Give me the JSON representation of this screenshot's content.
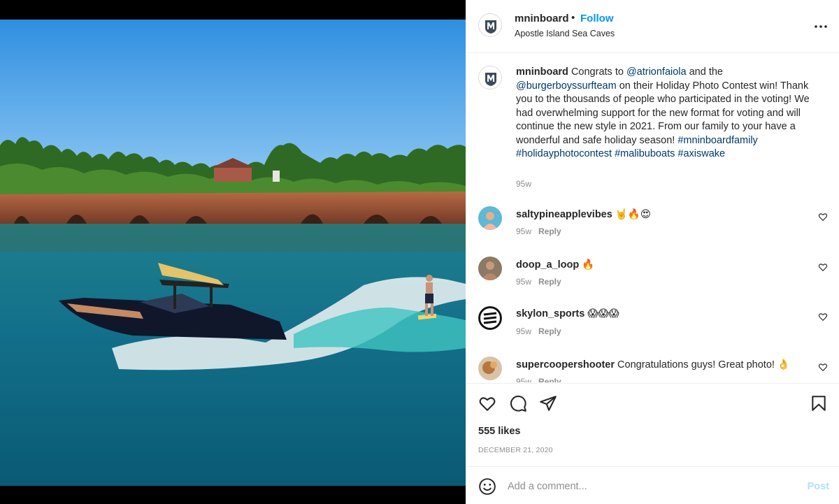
{
  "post": {
    "image_alt": "Wakesurf boat on lake near sandstone sea cave cliffs",
    "account": {
      "username": "mninboard",
      "separator": "•",
      "follow_label": "Follow",
      "location": "Apostle Island Sea Caves"
    },
    "caption": {
      "username": "mninboard",
      "t1": " Congrats to ",
      "mention1": "@atrionfaiola",
      "t2": " and the ",
      "mention2": "@burgerboyssurfteam",
      "t3": " on their Holiday Photo Contest win! Thank you to the thousands of people who participated in the voting! We had overwhelming support for the new format for voting and will continue the new style in 2021. From our family to your have a wonderful and safe holiday season! ",
      "tag1": "#mninboardfamily",
      "tag2": "#holidayphotocontest",
      "tag3": "#malibuboats",
      "tag4": "#axiswake",
      "time": "95w"
    },
    "comments": [
      {
        "username": "saltypineapplevibes",
        "text": "",
        "emoji": "🤘🔥😍",
        "time": "95w",
        "reply_label": "Reply"
      },
      {
        "username": "doop_a_loop",
        "text": "",
        "emoji": "🔥",
        "time": "95w",
        "reply_label": "Reply"
      },
      {
        "username": "skylon_sports",
        "text": "",
        "emoji": "😱😱😱",
        "time": "95w",
        "reply_label": "Reply"
      },
      {
        "username": "supercoopershooter",
        "text": " Congratulations guys! Great photo!",
        "emoji": "👌",
        "time": "95w",
        "reply_label": "Reply"
      }
    ],
    "likes": "555 likes",
    "date": "DECEMBER 21, 2020",
    "add_comment": {
      "placeholder": "Add a comment...",
      "post_label": "Post"
    }
  },
  "colors": {
    "follow": "#0095f6",
    "link": "#00376b",
    "muted": "#8e8e8e",
    "post_disabled": "#b2dffc"
  },
  "icons": [
    "more-icon",
    "heart-icon",
    "comment-icon",
    "share-icon",
    "bookmark-icon",
    "emoji-icon"
  ]
}
